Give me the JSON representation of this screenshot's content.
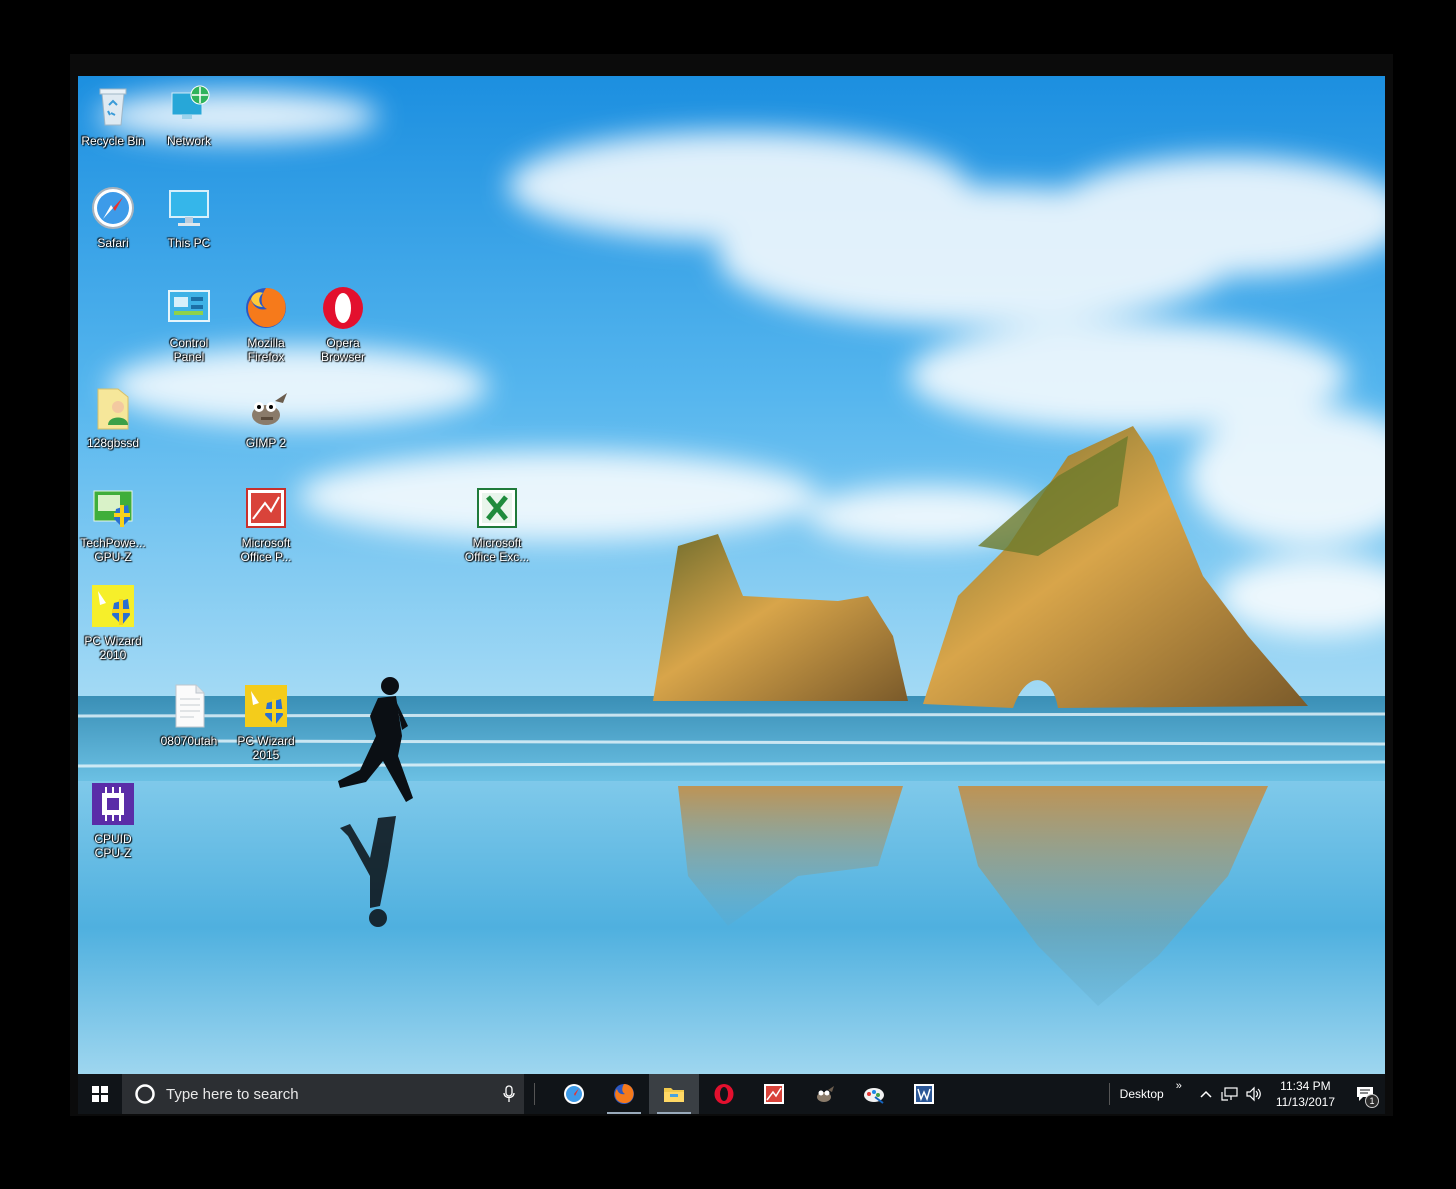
{
  "desktop": {
    "icons": [
      {
        "id": "recycle-bin",
        "label": "Recycle Bin",
        "icon": "recycle-bin-icon"
      },
      {
        "id": "network",
        "label": "Network",
        "icon": "network-icon"
      },
      {
        "id": "safari",
        "label": "Safari",
        "icon": "safari-icon"
      },
      {
        "id": "this-pc",
        "label": "This PC",
        "icon": "monitor-icon"
      },
      {
        "id": "control-panel",
        "label": "Control\nPanel",
        "icon": "control-panel-icon"
      },
      {
        "id": "mozilla-firefox",
        "label": "Mozilla\nFirefox",
        "icon": "firefox-icon"
      },
      {
        "id": "opera-browser",
        "label": "Opera\nBrowser",
        "icon": "opera-icon"
      },
      {
        "id": "128gbssd",
        "label": "128gbssd",
        "icon": "user-folder-icon"
      },
      {
        "id": "gimp",
        "label": "GIMP 2",
        "icon": "gimp-icon"
      },
      {
        "id": "gpu-z",
        "label": "TechPowe...\nGPU-Z",
        "icon": "gpu-z-icon"
      },
      {
        "id": "ms-powerpoint",
        "label": "Microsoft\nOffice P...",
        "icon": "powerpoint-icon"
      },
      {
        "id": "ms-excel",
        "label": "Microsoft\nOffice Exc...",
        "icon": "excel-icon"
      },
      {
        "id": "pc-wizard-2010",
        "label": "PC Wizard\n2010",
        "icon": "pc-wizard-icon"
      },
      {
        "id": "file-08070utah",
        "label": "08070utah",
        "icon": "text-file-icon"
      },
      {
        "id": "pc-wizard-2015",
        "label": "PC Wizard\n2015",
        "icon": "pc-wizard-icon"
      },
      {
        "id": "cpuid-cpu-z",
        "label": "CPUID\nCPU-Z",
        "icon": "cpu-z-icon"
      }
    ]
  },
  "taskbar": {
    "search_placeholder": "Type here to search",
    "pinned": [
      {
        "id": "safari",
        "icon": "safari-icon"
      },
      {
        "id": "firefox",
        "icon": "firefox-icon"
      },
      {
        "id": "file-explorer",
        "icon": "folder-icon"
      },
      {
        "id": "opera",
        "icon": "opera-icon"
      },
      {
        "id": "powerpoint",
        "icon": "powerpoint-icon"
      },
      {
        "id": "gimp",
        "icon": "gimp-icon"
      },
      {
        "id": "paint",
        "icon": "paint-icon"
      },
      {
        "id": "word",
        "icon": "word-icon"
      }
    ],
    "desktop_toolbar_label": "Desktop",
    "overflow_label": "»",
    "time": "11:34 PM",
    "date": "11/13/2017",
    "notification_count": "1"
  }
}
